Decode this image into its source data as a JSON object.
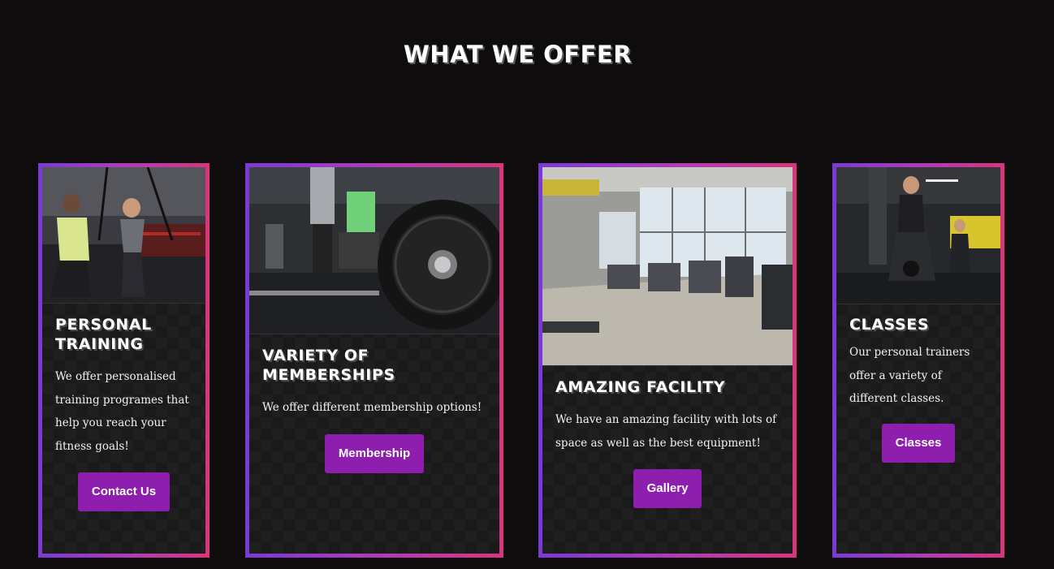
{
  "section": {
    "title": "WHAT WE OFFER"
  },
  "cards": [
    {
      "image": "personal-training-photo",
      "title": "PERSONAL TRAINING",
      "text": "We offer personalised training programes that help you reach your fitness goals!",
      "button": "Contact Us"
    },
    {
      "image": "barbell-plate-photo",
      "title": "VARIETY OF MEMBERSHIPS",
      "text": "We offer different membership options!",
      "button": "Membership"
    },
    {
      "image": "gym-facility-photo",
      "title": "AMAZING FACILITY",
      "text": "We have an amazing facility with lots of space as well as the best equipment!",
      "button": "Gallery"
    },
    {
      "image": "kettlebell-class-photo",
      "title": "CLASSES",
      "text": "Our personal trainers offer a variety of different classes.",
      "button": "Classes"
    }
  ],
  "colors": {
    "background": "#0e0c0d",
    "card_border_start": "#7a3ad6",
    "card_border_end": "#d8357a",
    "button": "#8e1fae"
  }
}
